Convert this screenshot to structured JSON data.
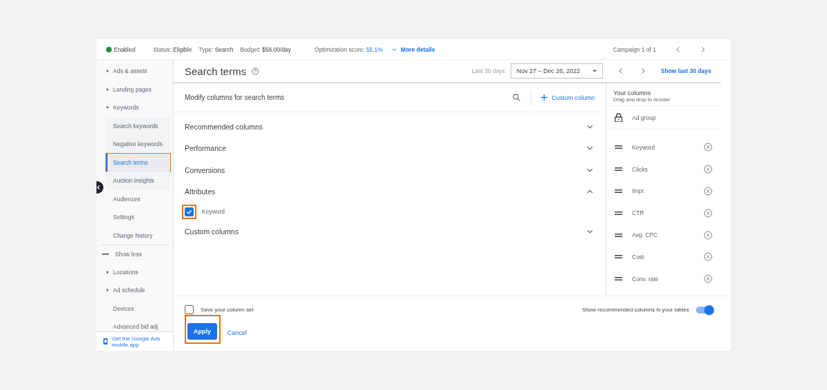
{
  "summary_bar": {
    "status": {
      "label": "Enabled",
      "color": "#1e8e3e"
    },
    "items": [
      {
        "label": "Status:",
        "value": "Eligible"
      },
      {
        "label": "Type:",
        "value": "Search"
      },
      {
        "label": "Budget:",
        "value": "$56.00/day"
      }
    ],
    "score": {
      "label": "Optimization score:",
      "value": "55.1%"
    },
    "more_details": "More details",
    "campaign": "Campaign 1 of 1"
  },
  "sidebar": {
    "items": [
      {
        "label": "Ads & assets",
        "kind": "group",
        "expanded": false
      },
      {
        "label": "Landing pages",
        "kind": "group",
        "expanded": false
      },
      {
        "label": "Keywords",
        "kind": "group",
        "expanded": true,
        "children": [
          {
            "label": "Search keywords",
            "selected": false,
            "highlighted": false
          },
          {
            "label": "Negative keywords",
            "selected": false,
            "highlighted": false
          },
          {
            "label": "Search terms",
            "selected": true,
            "highlighted": true
          },
          {
            "label": "Auction insights",
            "selected": false,
            "highlighted": false
          }
        ]
      },
      {
        "label": "Audiences",
        "kind": "item"
      },
      {
        "label": "Settings",
        "kind": "item"
      },
      {
        "label": "Change history",
        "kind": "item"
      },
      {
        "label": "Show less",
        "kind": "toggle"
      },
      {
        "label": "Locations",
        "kind": "group",
        "expanded": false
      },
      {
        "label": "Ad schedule",
        "kind": "group",
        "expanded": false
      },
      {
        "label": "Devices",
        "kind": "item"
      },
      {
        "label": "Advanced bid adj",
        "kind": "item"
      }
    ],
    "app_promo": "Get the Google Ads mobile app"
  },
  "header": {
    "title": "Search terms",
    "range_label": "Last 30 days",
    "date_range": "Nov 27 – Dec 26, 2022",
    "show_last": "Show last 30 days"
  },
  "modify": {
    "title": "Modify columns for search terms",
    "custom_column": "Custom column",
    "sections": [
      {
        "label": "Recommended columns",
        "expanded": false
      },
      {
        "label": "Performance",
        "expanded": false
      },
      {
        "label": "Conversions",
        "expanded": false
      },
      {
        "label": "Attributes",
        "expanded": true,
        "options": [
          {
            "label": "Keyword",
            "checked": true,
            "highlighted": true
          }
        ]
      },
      {
        "label": "Custom columns",
        "expanded": false
      }
    ]
  },
  "your_columns": {
    "title": "Your columns",
    "subtitle": "Drag and drop to reorder",
    "columns": [
      {
        "label": "Ad group",
        "kind": "locked"
      },
      {
        "label": "Keyword",
        "kind": "movable"
      },
      {
        "label": "Clicks",
        "kind": "movable"
      },
      {
        "label": "Impr.",
        "kind": "movable"
      },
      {
        "label": "CTR",
        "kind": "movable"
      },
      {
        "label": "Avg. CPC",
        "kind": "movable"
      },
      {
        "label": "Cost",
        "kind": "movable"
      },
      {
        "label": "Conv. rate",
        "kind": "movable"
      }
    ]
  },
  "footer": {
    "save": {
      "label": "Save your column set",
      "checked": false
    },
    "recommended": {
      "label": "Show recommended columns in your tables",
      "on": true
    },
    "apply": {
      "label": "Apply",
      "highlighted": true
    },
    "cancel": "Cancel"
  }
}
